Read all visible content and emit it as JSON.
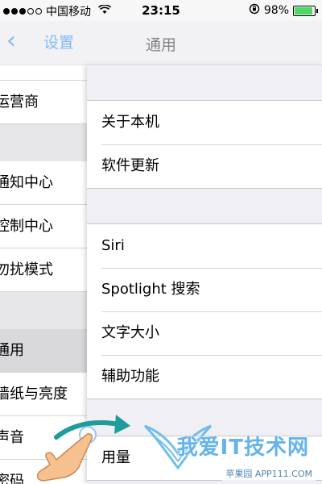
{
  "status_bar": {
    "carrier": "中国移动",
    "time": "23:15",
    "battery_percent": "98%",
    "battery_level": 0.98,
    "icons": [
      "signal-dots-icon",
      "wifi-icon",
      "rotation-lock-icon",
      "battery-icon"
    ]
  },
  "nav": {
    "back_label": "设置",
    "title": "通用"
  },
  "left_pane": {
    "items": [
      {
        "label": "运营商"
      },
      {
        "label": "通知中心"
      },
      {
        "label": "控制中心"
      },
      {
        "label": "勿扰模式"
      },
      {
        "label": "通用"
      },
      {
        "label": "墙纸与亮度"
      },
      {
        "label": "声音"
      },
      {
        "label": "密码"
      }
    ]
  },
  "groups": [
    {
      "rows": [
        {
          "label": "关于本机"
        },
        {
          "label": "软件更新"
        }
      ]
    },
    {
      "rows": [
        {
          "label": "Siri"
        },
        {
          "label": "Spotlight 搜索"
        },
        {
          "label": "文字大小"
        },
        {
          "label": "辅助功能"
        }
      ]
    },
    {
      "rows": [
        {
          "label": "用量"
        }
      ]
    }
  ],
  "watermark": {
    "title": "我爱IT技术网",
    "subtitle": "苹果园 APP111.COM"
  },
  "colors": {
    "accent": "#007aff",
    "battery_green": "#4cd964",
    "background": "#efeff4"
  }
}
